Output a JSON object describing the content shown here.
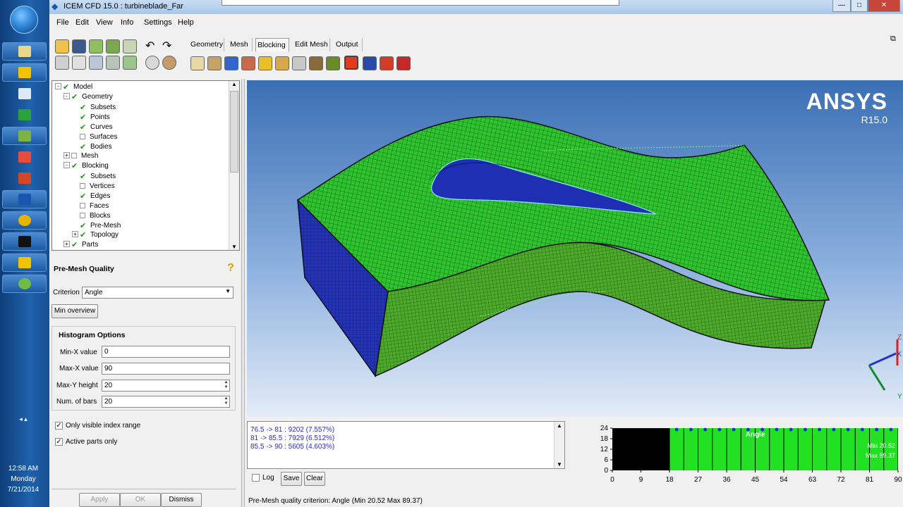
{
  "window": {
    "title": "ICEM CFD 15.0 : turbineblade_Far",
    "controls": {
      "minimize": "—",
      "maximize": "□",
      "close": "✕"
    }
  },
  "menu": [
    "File",
    "Edit",
    "View",
    "Info",
    "Settings",
    "Help"
  ],
  "tabs": [
    {
      "label": "Geometry",
      "active": false
    },
    {
      "label": "Mesh",
      "active": false
    },
    {
      "label": "Blocking",
      "active": true
    },
    {
      "label": "Edit Mesh",
      "active": false
    },
    {
      "label": "Output",
      "active": false
    }
  ],
  "tree": [
    {
      "label": "Model",
      "indent": 0,
      "checked": true,
      "expander": "-"
    },
    {
      "label": "Geometry",
      "indent": 1,
      "checked": true,
      "expander": "-"
    },
    {
      "label": "Subsets",
      "indent": 2,
      "checked": true,
      "expander": ""
    },
    {
      "label": "Points",
      "indent": 2,
      "checked": true,
      "expander": ""
    },
    {
      "label": "Curves",
      "indent": 2,
      "checked": true,
      "expander": ""
    },
    {
      "label": "Surfaces",
      "indent": 2,
      "checked": false,
      "expander": ""
    },
    {
      "label": "Bodies",
      "indent": 2,
      "checked": true,
      "expander": ""
    },
    {
      "label": "Mesh",
      "indent": 1,
      "checked": false,
      "expander": "+"
    },
    {
      "label": "Blocking",
      "indent": 1,
      "checked": true,
      "expander": "-"
    },
    {
      "label": "Subsets",
      "indent": 2,
      "checked": true,
      "expander": ""
    },
    {
      "label": "Vertices",
      "indent": 2,
      "checked": false,
      "expander": ""
    },
    {
      "label": "Edges",
      "indent": 2,
      "checked": true,
      "expander": ""
    },
    {
      "label": "Faces",
      "indent": 2,
      "checked": false,
      "expander": ""
    },
    {
      "label": "Blocks",
      "indent": 2,
      "checked": false,
      "expander": ""
    },
    {
      "label": "Pre-Mesh",
      "indent": 2,
      "checked": true,
      "expander": ""
    },
    {
      "label": "Topology",
      "indent": 2,
      "checked": true,
      "expander": "+"
    },
    {
      "label": "Parts",
      "indent": 1,
      "checked": true,
      "expander": "+"
    }
  ],
  "premesh": {
    "title": "Pre-Mesh Quality",
    "criterion_label": "Criterion",
    "criterion_value": "Angle",
    "min_overview_label": "Min overview",
    "histogram_title": "Histogram Options",
    "min_x_label": "Min-X value",
    "min_x_value": "0",
    "max_x_label": "Max-X value",
    "max_x_value": "90",
    "max_y_label": "Max-Y height",
    "max_y_value": "20",
    "num_bars_label": "Num. of bars",
    "num_bars_value": "20",
    "only_visible_label": "Only visible index range",
    "active_parts_label": "Active parts only",
    "apply_label": "Apply",
    "ok_label": "OK",
    "dismiss_label": "Dismiss"
  },
  "viewport": {
    "logo": "ANSYS",
    "version": "R15.0",
    "axis_x": "X",
    "axis_y": "Y",
    "axis_z": "Z"
  },
  "messages": [
    "76.5 -> 81 : 9202 (7.557%)",
    "81 -> 85.5 : 7929 (6.512%)",
    "85.5 -> 90 : 5605 (4.603%)"
  ],
  "message_controls": {
    "log_label": "Log",
    "save_label": "Save",
    "clear_label": "Clear"
  },
  "chart_data": {
    "type": "bar",
    "title": "Angle",
    "x_ticks": [
      0,
      9,
      18,
      27,
      36,
      45,
      54,
      63,
      72,
      81,
      90
    ],
    "y_ticks": [
      0,
      6,
      12,
      18,
      24
    ],
    "xlim": [
      0,
      90
    ],
    "ylim": [
      0,
      24
    ],
    "categories": [
      "0-4.5",
      "4.5-9",
      "9-13.5",
      "13.5-18",
      "18-22.5",
      "22.5-27",
      "27-31.5",
      "31.5-36",
      "36-40.5",
      "40.5-45",
      "45-49.5",
      "49.5-54",
      "54-58.5",
      "58.5-63",
      "63-67.5",
      "67.5-72",
      "72-76.5",
      "76.5-81",
      "81-85.5",
      "85.5-90"
    ],
    "values": [
      0,
      0,
      0,
      0,
      24,
      24,
      24,
      24,
      24,
      24,
      24,
      24,
      24,
      24,
      24,
      24,
      24,
      24,
      24,
      24
    ],
    "annotations": [
      "Min 20.52",
      "Max 89.37"
    ],
    "colors": {
      "bar": "#22e022",
      "background": "#000000",
      "marker": "#1a2ad8"
    }
  },
  "status": "Pre-Mesh quality criterion: Angle (Min 20.52 Max 89.37)",
  "taskbar": {
    "clock_time": "12:58 AM",
    "clock_day": "Monday",
    "clock_date": "7/21/2014"
  }
}
